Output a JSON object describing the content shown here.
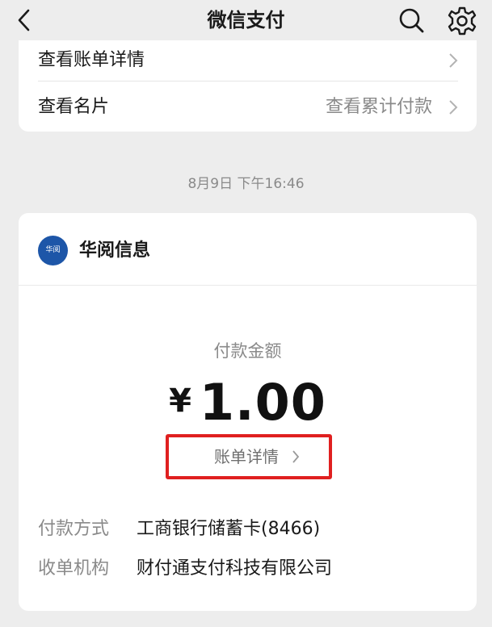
{
  "header": {
    "title": "微信支付"
  },
  "top_card": {
    "bill_detail_row": {
      "label": "查看账单详情"
    },
    "business_card_row": {
      "label": "查看名片",
      "value": "查看累计付款"
    }
  },
  "timestamp": "8月9日 下午16:46",
  "transaction": {
    "merchant_name": "华阅信息",
    "merchant_logo_text": "华阅",
    "amount_label": "付款金额",
    "currency_symbol": "¥",
    "amount": "1.00",
    "bill_detail_label": "账单详情",
    "details": [
      {
        "label": "付款方式",
        "value": "工商银行储蓄卡(8466)"
      },
      {
        "label": "收单机构",
        "value": "财付通支付科技有限公司"
      }
    ]
  },
  "colors": {
    "background": "#ededed",
    "card": "#ffffff",
    "highlight_box": "#e02020",
    "merchant_logo": "#1d56a8",
    "secondary_text": "#8a8a8a"
  }
}
